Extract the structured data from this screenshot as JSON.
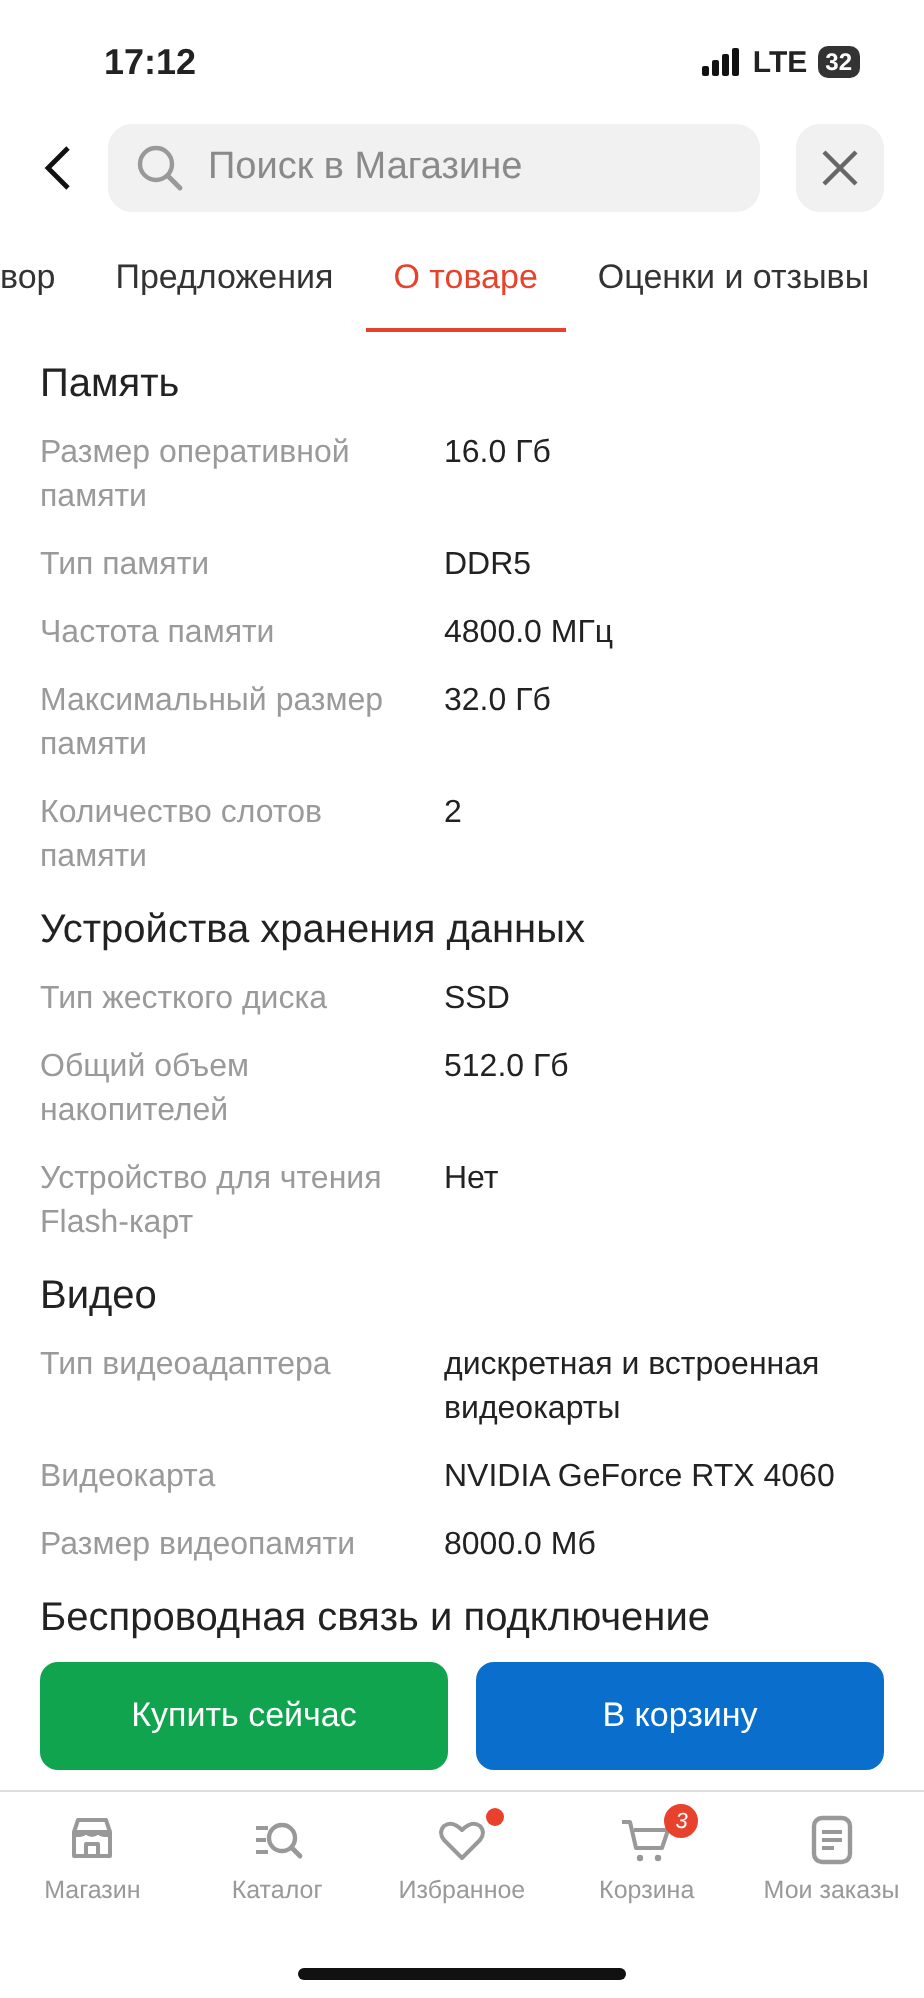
{
  "status_bar": {
    "time": "17:12",
    "network": "LTE",
    "battery": "32"
  },
  "search": {
    "placeholder": "Поиск в Магазине"
  },
  "tabs": [
    {
      "label": "вор",
      "selected": false
    },
    {
      "label": "Предложения",
      "selected": false
    },
    {
      "label": "О товаре",
      "selected": true
    },
    {
      "label": "Оценки и отзывы",
      "selected": false
    }
  ],
  "sections": [
    {
      "title": "Память",
      "rows": [
        {
          "label": "Размер оперативной памяти",
          "value": "16.0 Гб"
        },
        {
          "label": "Тип памяти",
          "value": "DDR5"
        },
        {
          "label": "Частота памяти",
          "value": "4800.0 МГц"
        },
        {
          "label": "Максимальный размер памяти",
          "value": "32.0 Гб"
        },
        {
          "label": "Количество слотов памяти",
          "value": "2"
        }
      ]
    },
    {
      "title": "Устройства хранения данных",
      "rows": [
        {
          "label": "Тип жесткого диска",
          "value": "SSD"
        },
        {
          "label": "Общий объем накопителей",
          "value": "512.0 Гб"
        },
        {
          "label": "Устройство для чтения Flash-карт",
          "value": "Нет"
        }
      ]
    },
    {
      "title": "Видео",
      "rows": [
        {
          "label": "Тип видеоадаптера",
          "value": "дискретная и встроенная видеокарты"
        },
        {
          "label": "Видеокарта",
          "value": "NVIDIA GeForce RTX 4060"
        },
        {
          "label": "Размер видеопамяти",
          "value": "8000.0 Мб"
        }
      ]
    },
    {
      "title": "Беспроводная связь и подключение"
    }
  ],
  "actions": [
    {
      "label": "Купить сейчас",
      "kind": "buy"
    },
    {
      "label": "В корзину",
      "kind": "cart"
    }
  ],
  "nav": [
    {
      "label": "Магазин",
      "kind": "store",
      "dot": false
    },
    {
      "label": "Каталог",
      "kind": "catalog",
      "dot": false
    },
    {
      "label": "Избранное",
      "kind": "heart",
      "dot": true
    },
    {
      "label": "Корзина",
      "kind": "cart",
      "dot": false,
      "badge": "3"
    },
    {
      "label": "Мои заказы",
      "kind": "orders",
      "dot": false
    }
  ]
}
